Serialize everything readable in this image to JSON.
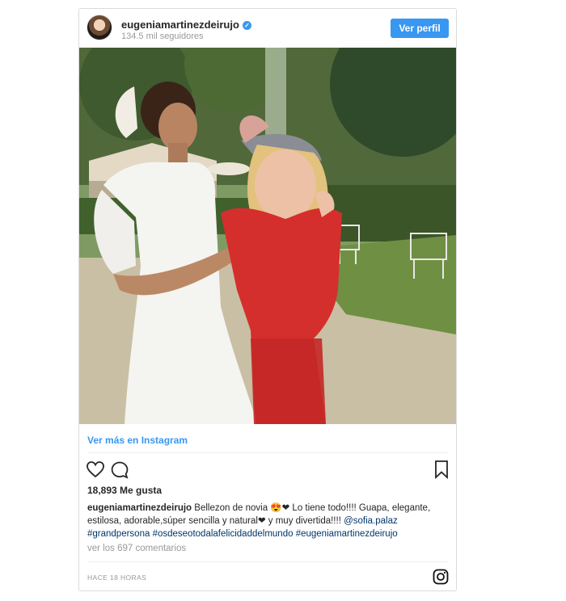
{
  "post": {
    "username": "eugeniamartinezdeirujo",
    "followers": "134.5 mil seguidores",
    "view_profile": "Ver perfil",
    "view_more": "Ver más en Instagram",
    "likes": "18,893 Me gusta",
    "caption": {
      "username": "eugeniamartinezdeirujo",
      "text_1": "Bellezon de novia 😍❤ Lo tiene todo!!!! Guapa, elegante, estilosa, adorable,súper sencilla y natural❤ y muy divertida!!!!",
      "mention": "@sofia.palaz",
      "hashtags": [
        "#grandpersona",
        "#osdeseotodalafelicidaddelmundo",
        "#eugeniamartinezdeirujo"
      ]
    },
    "comments": "ver los 697 comentarios",
    "date": "HACE 18 HORAS"
  },
  "icons": {
    "like": "heart-icon",
    "comment": "comment-icon",
    "save": "bookmark-icon",
    "brand": "instagram-icon"
  },
  "colors": {
    "accent": "#3897f0",
    "link": "#003569"
  }
}
